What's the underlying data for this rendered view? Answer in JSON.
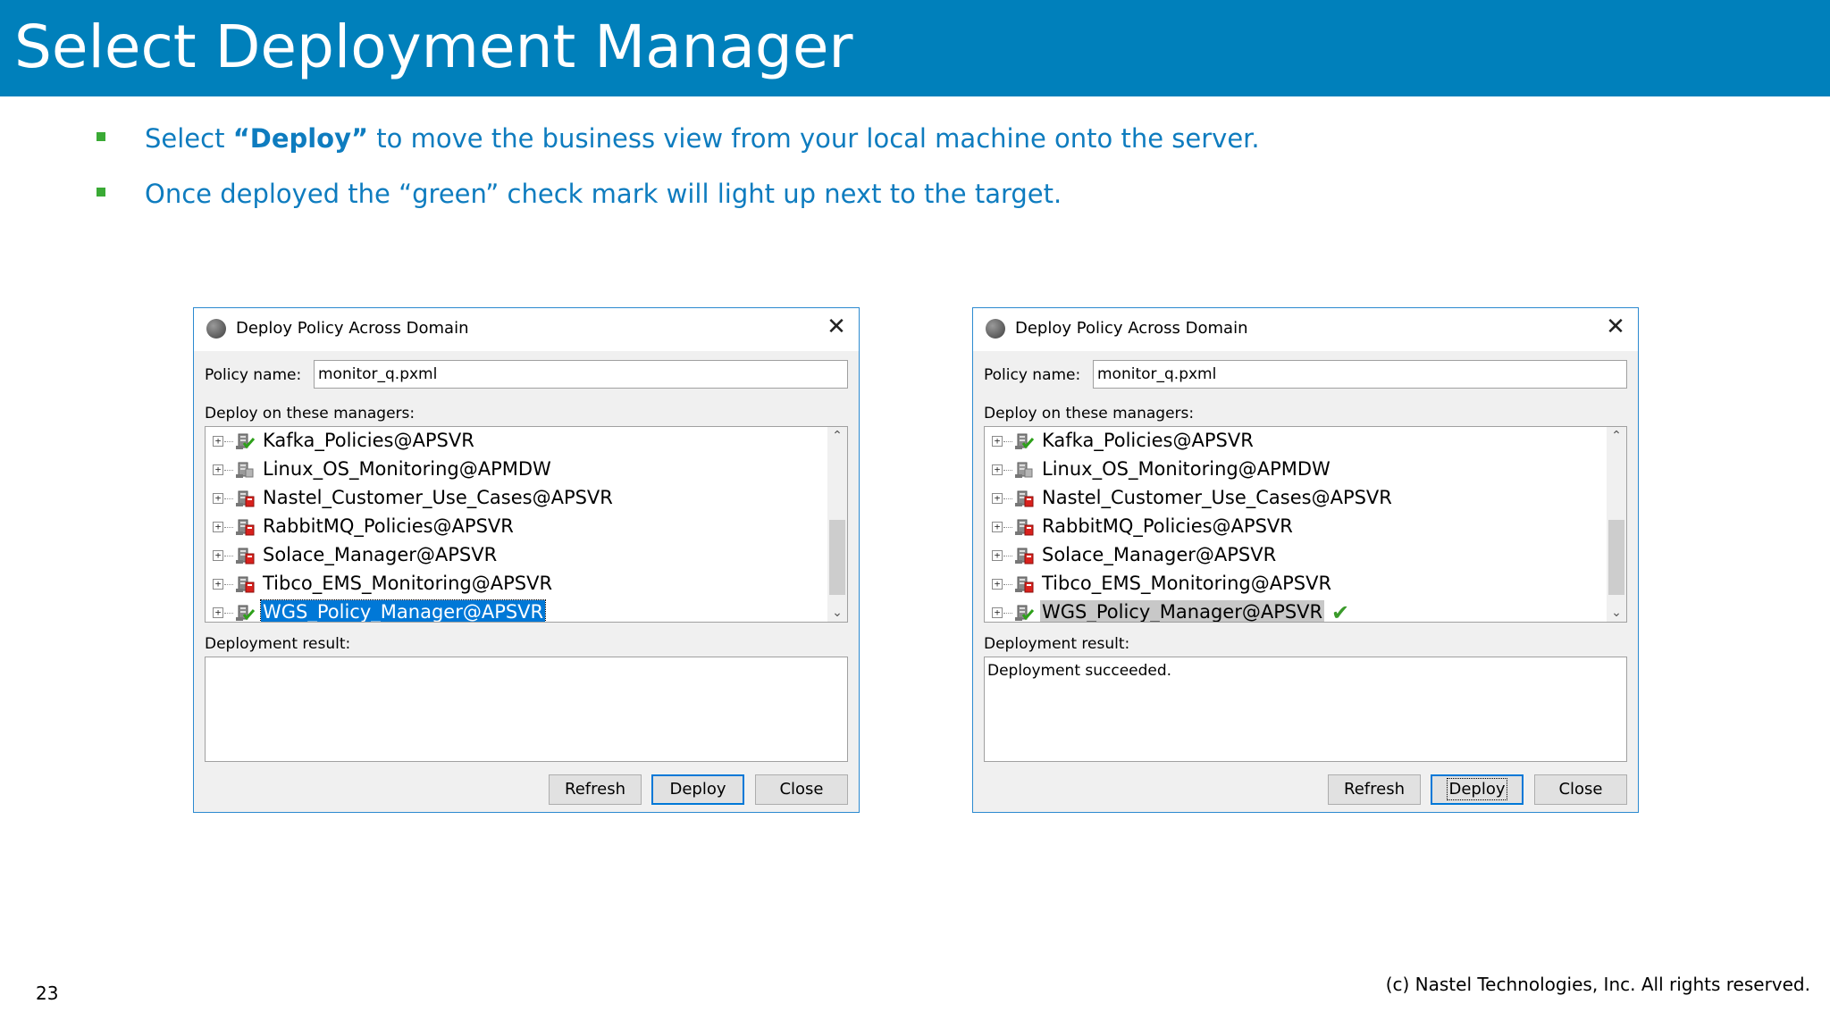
{
  "slide": {
    "title": "Select Deployment Manager",
    "bullets": [
      {
        "pre": "Select ",
        "bold": "“Deploy”",
        "post": " to move the business view from your local machine onto the server."
      },
      {
        "pre": "Once deployed the “green” check mark will light up next to the target.",
        "bold": "",
        "post": ""
      }
    ],
    "page_number": "23",
    "copyright": "(c) Nastel Technologies, Inc. All rights reserved."
  },
  "colors": {
    "header_bg": "#0080bb",
    "bullet_text": "#0e7cbf",
    "bullet_square": "#3aaa35",
    "selection_blue": "#0078d7",
    "check_green": "#3a9a2a"
  },
  "dialogs": [
    {
      "title": "Deploy Policy Across Domain",
      "policy_label": "Policy name:",
      "policy_value": "monitor_q.pxml",
      "managers_label": "Deploy on these managers:",
      "managers": [
        {
          "name": "Kafka_Policies@APSVR",
          "icon": "server-green-icon"
        },
        {
          "name": "Linux_OS_Monitoring@APMDW",
          "icon": "server-gray-icon"
        },
        {
          "name": "Nastel_Customer_Use_Cases@APSVR",
          "icon": "server-red-icon"
        },
        {
          "name": "RabbitMQ_Policies@APSVR",
          "icon": "server-red-icon"
        },
        {
          "name": "Solace_Manager@APSVR",
          "icon": "server-red-icon"
        },
        {
          "name": "Tibco_EMS_Monitoring@APSVR",
          "icon": "server-red-icon"
        },
        {
          "name": "WGS_Policy_Manager@APSVR",
          "icon": "server-green-icon"
        }
      ],
      "selected_index": 6,
      "selection_style": "focused",
      "result_label": "Deployment result:",
      "result_text": "",
      "buttons": {
        "refresh": "Refresh",
        "deploy": "Deploy",
        "close": "Close"
      }
    },
    {
      "title": "Deploy Policy Across Domain",
      "policy_label": "Policy name:",
      "policy_value": "monitor_q.pxml",
      "managers_label": "Deploy on these managers:",
      "managers": [
        {
          "name": "Kafka_Policies@APSVR",
          "icon": "server-green-icon"
        },
        {
          "name": "Linux_OS_Monitoring@APMDW",
          "icon": "server-gray-icon"
        },
        {
          "name": "Nastel_Customer_Use_Cases@APSVR",
          "icon": "server-red-icon"
        },
        {
          "name": "RabbitMQ_Policies@APSVR",
          "icon": "server-red-icon"
        },
        {
          "name": "Solace_Manager@APSVR",
          "icon": "server-red-icon"
        },
        {
          "name": "Tibco_EMS_Monitoring@APSVR",
          "icon": "server-red-icon"
        },
        {
          "name": "WGS_Policy_Manager@APSVR",
          "icon": "server-green-icon",
          "deployed": true
        }
      ],
      "selected_index": 6,
      "selection_style": "inactive",
      "result_label": "Deployment result:",
      "result_text": "Deployment succeeded.",
      "buttons": {
        "refresh": "Refresh",
        "deploy": "Deploy",
        "close": "Close"
      }
    }
  ]
}
